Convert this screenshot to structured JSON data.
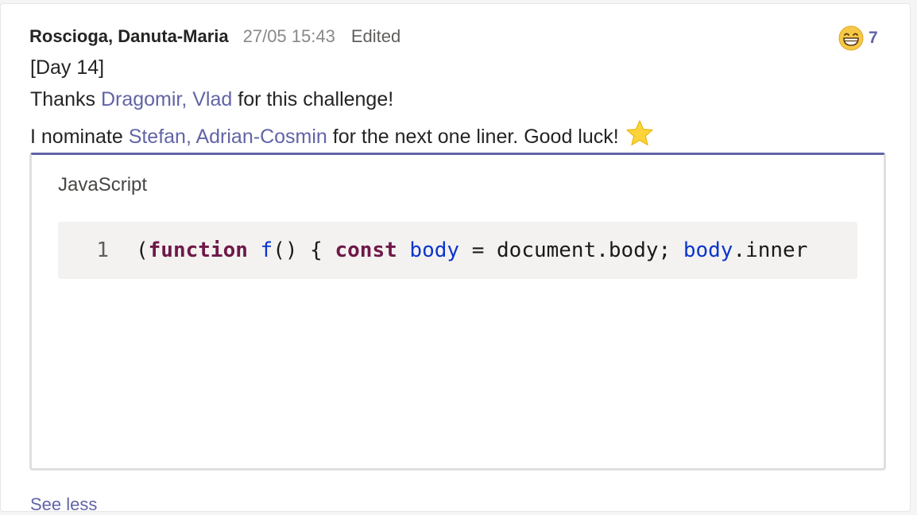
{
  "message": {
    "author": "Roscioga, Danuta-Maria",
    "timestamp": "27/05 15:43",
    "edited_label": "Edited",
    "reaction": {
      "emoji": "grinning-face-icon",
      "count": "7"
    },
    "lines": {
      "line1": "[Day 14]",
      "line2_prefix": "Thanks ",
      "line2_mention": "Dragomir, Vlad",
      "line2_suffix": " for this challenge!",
      "line3_prefix": "I nominate ",
      "line3_mention": "Stefan, Adrian-Cosmin",
      "line3_suffix": " for the next one liner. Good luck!"
    },
    "star_icon": "star-icon"
  },
  "code_block": {
    "language": "JavaScript",
    "line_number": "1",
    "tokens": {
      "t1": "(",
      "t2": "function",
      "t3": " ",
      "t4": "f",
      "t5": "() { ",
      "t6": "const",
      "t7": " ",
      "t8": "body",
      "t9": " = document.body; ",
      "t10": "body",
      "t11": ".inner"
    }
  },
  "footer": {
    "partial_link": "See less"
  },
  "colors": {
    "accent": "#6264a7",
    "keyword": "#6f1848",
    "identifier": "#0b34cc"
  }
}
